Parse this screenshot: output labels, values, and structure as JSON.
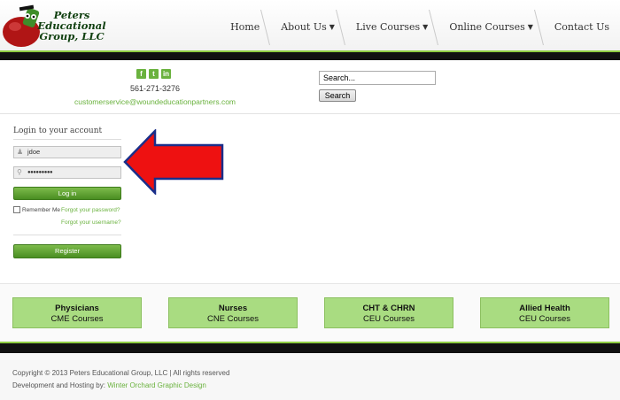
{
  "logo": {
    "line1": "Peters",
    "line2": "Educational",
    "line3": "Group, LLC"
  },
  "nav": {
    "items": [
      {
        "label": "Home"
      },
      {
        "label": "About Us"
      },
      {
        "label": "Live Courses"
      },
      {
        "label": "Online Courses"
      },
      {
        "label": "Contact Us"
      }
    ]
  },
  "contact": {
    "phone": "561-271-3276",
    "email": "customerservice@woundeducationpartners.com",
    "social_icons": [
      "facebook-icon",
      "twitter-icon",
      "linkedin-icon"
    ]
  },
  "search": {
    "value": "Search...",
    "button_label": "Search"
  },
  "login": {
    "title": "Login to your account",
    "username_value": "jdoe",
    "password_value": "●●●●●●●●●",
    "login_label": "Log in",
    "remember_label": "Remember Me",
    "forgot_password": "Forgot your password?",
    "forgot_username": "Forgot your username?",
    "register_label": "Register"
  },
  "categories": [
    {
      "title": "Physicians",
      "subtitle": "CME Courses"
    },
    {
      "title": "Nurses",
      "subtitle": "CNE Courses"
    },
    {
      "title": "CHT & CHRN",
      "subtitle": "CEU Courses"
    },
    {
      "title": "Allied Health",
      "subtitle": "CEU Courses"
    }
  ],
  "footer": {
    "copyright": "Copyright © 2013 Peters Educational Group, LLC | All rights reserved",
    "dev_prefix": "Development and Hosting by:",
    "dev_link": "Winter Orchard Graphic Design"
  },
  "colors": {
    "accent_green": "#8fcd42",
    "link_green": "#6ab23e",
    "arrow_red": "#ee1111",
    "arrow_outline": "#1a2f8a"
  }
}
